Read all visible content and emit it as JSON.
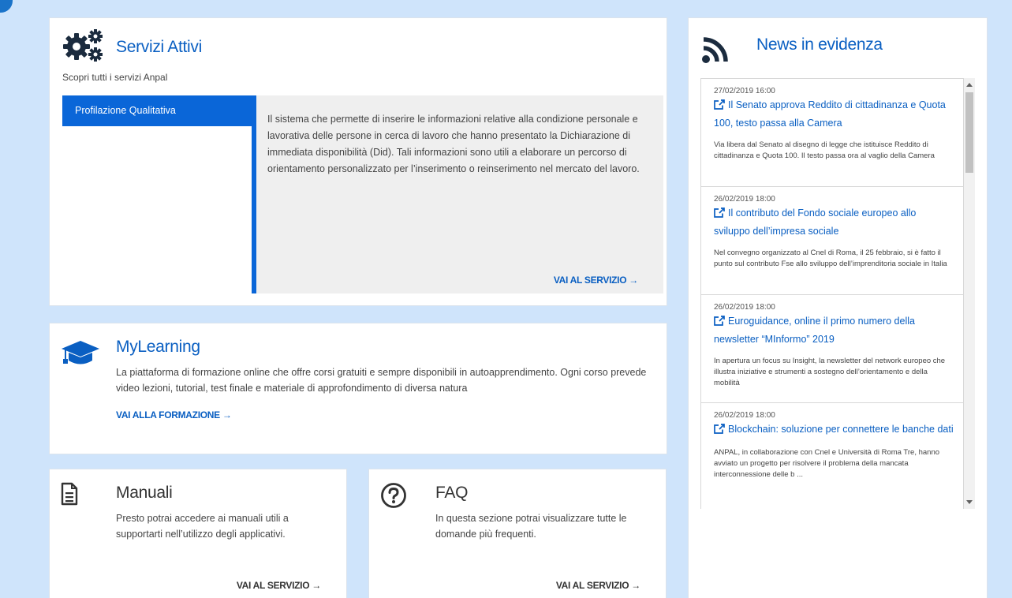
{
  "servizi": {
    "title": "Servizi Attivi",
    "subtitle": "Scopri tutti i servizi Anpal",
    "tab_label": "Profilazione Qualitativa",
    "description": "Il sistema che permette di inserire le informazioni relative alla condizione personale e lavorativa delle persone in cerca di lavoro che hanno presentato la Dichiarazione di immediata disponibilità (Did). Tali informazioni sono utili a elaborare un percorso di orientamento personalizzato per l’inserimento o reinserimento nel mercato del lavoro.",
    "link": "VAI AL SERVIZIO →"
  },
  "mylearning": {
    "title": "MyLearning",
    "description": "La piattaforma di formazione online che offre corsi gratuiti e sempre disponibili in autoapprendimento. Ogni corso prevede video lezioni, tutorial, test finale e materiale di approfondimento di diversa natura",
    "link": "VAI ALLA FORMAZIONE →"
  },
  "manuali": {
    "title": "Manuali",
    "description": "Presto potrai accedere ai manuali utili a supportarti nell’utilizzo degli applicativi.",
    "link": "VAI AL SERVIZIO →"
  },
  "faq": {
    "title": "FAQ",
    "description": "In questa sezione potrai visualizzare tutte le domande più frequenti.",
    "link": "VAI AL SERVIZIO →"
  },
  "news": {
    "title": "News in evidenza",
    "items": [
      {
        "date": "27/02/2019 16:00",
        "title": "Il Senato approva Reddito di cittadinanza e Quota 100, testo passa alla Camera",
        "desc": "Via libera dal Senato al disegno di legge che istituisce Reddito di cittadinanza e Quota 100. Il testo passa ora al vaglio della Camera"
      },
      {
        "date": "26/02/2019 18:00",
        "title": "Il contributo del Fondo sociale europeo allo sviluppo dell’impresa sociale",
        "desc": "Nel convegno organizzato al Cnel di Roma, il 25 febbraio, si è fatto il punto sul contributo Fse allo sviluppo dell’imprenditoria sociale in Italia"
      },
      {
        "date": "26/02/2019 18:00",
        "title": "Euroguidance, online il primo numero della newsletter “MInformo” 2019",
        "desc": "In apertura un focus su Insight, la newsletter del network europeo che illustra iniziative e strumenti a sostegno dell’orientamento e della mobilità"
      },
      {
        "date": "26/02/2019 18:00",
        "title": "Blockchain: soluzione per connettere le banche dati",
        "desc": "ANPAL, in collaborazione con Cnel e Università di Roma Tre, hanno avviato un progetto per risolvere il problema della mancata interconnessione delle b ..."
      }
    ]
  },
  "colors": {
    "accent": "#0a66d8",
    "link": "#0a5fc2",
    "background": "#cfe4fb"
  },
  "icons": {
    "servizi": "gears-icon",
    "mylearning": "graduation-cap-icon",
    "manuali": "document-icon",
    "faq": "question-circle-icon",
    "news": "rss-icon",
    "news_link": "external-link-icon"
  }
}
